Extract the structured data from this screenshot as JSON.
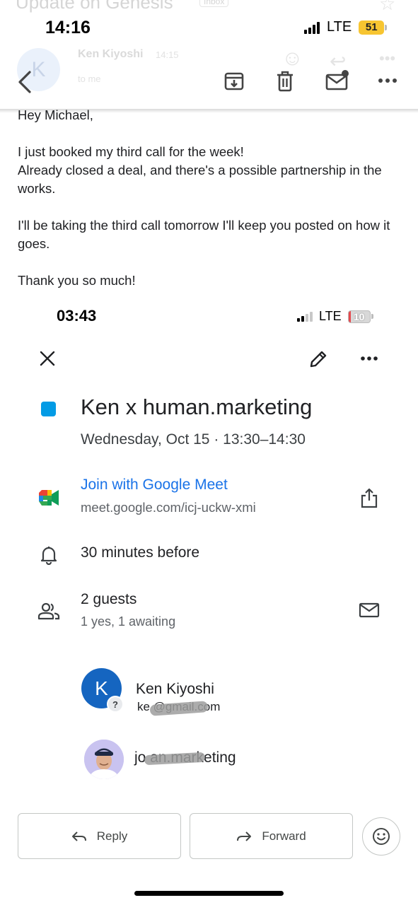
{
  "gmail_header": {
    "subject": "Update on Genesis",
    "inbox_badge": "Inbox",
    "sender_name": "Ken Kiyoshi",
    "sent_time": "14:15",
    "recipient": "to me",
    "sender_initial": "K"
  },
  "status_bar": {
    "time": "14:16",
    "network": "LTE",
    "battery": "51",
    "battery_color": "#f7c531"
  },
  "toolbar": {
    "icons": [
      "back-arrow-icon",
      "archive-icon",
      "trash-icon",
      "mark-unread-icon",
      "more-icon"
    ]
  },
  "email": {
    "greeting": "Hey Michael,",
    "line1": "I just booked my third call for the week!",
    "line2": "Already closed a deal, and there's a possible partnership in the works.",
    "line3": "I'll be taking the third call tomorrow I'll keep you posted on how it goes.",
    "closing": "Thank you so much!"
  },
  "embedded": {
    "status_bar": {
      "time": "03:43",
      "network": "LTE",
      "battery": "10",
      "battery_color": "#e5484d"
    },
    "event": {
      "color": "#039be5",
      "title": "Ken x human.marketing",
      "datetime": "Wednesday, Oct 15 · 13:30–14:30",
      "meet_label": "Join with Google Meet",
      "meet_url": "meet.google.com/icj-uckw-xmi",
      "reminder": "30 minutes before",
      "guests_count": "2 guests",
      "guests_status": "1 yes, 1 awaiting",
      "guests": [
        {
          "initial": "K",
          "name": "Ken Kiyoshi",
          "email": "ke           @gmail.com",
          "status_badge": "?"
        },
        {
          "email": "jo         an.marketing"
        }
      ]
    }
  },
  "actions": {
    "reply": "Reply",
    "forward": "Forward"
  }
}
